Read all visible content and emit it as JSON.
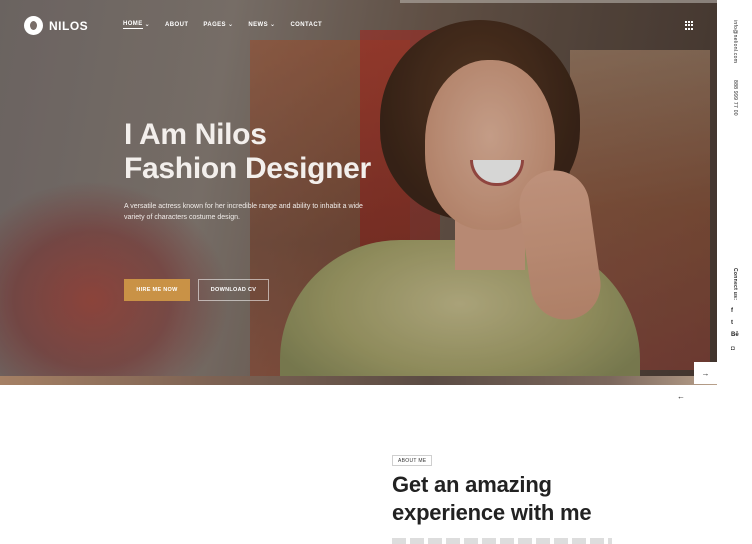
{
  "brand": {
    "name": "NILOS"
  },
  "nav": [
    {
      "label": "HOME",
      "dropdown": true,
      "active": true
    },
    {
      "label": "ABOUT",
      "dropdown": false
    },
    {
      "label": "PAGES",
      "dropdown": true
    },
    {
      "label": "NEWS",
      "dropdown": true
    },
    {
      "label": "CONTACT",
      "dropdown": false
    }
  ],
  "hero": {
    "title_line1": "I Am Nilos",
    "title_line2": "Fashion Designer",
    "description": "A versatile actress known for her incredible range and ability to inhabit a wide variety of characters costume design.",
    "hire_button": "HIRE ME NOW",
    "cv_button": "DOWNLOAD CV",
    "accent_color": "#c99246"
  },
  "sidebar": {
    "email": "info@nelionl.com",
    "phone": "888 999 77 00",
    "connect": "Connect us:",
    "socials": [
      "f",
      "t",
      "Bē",
      "◘"
    ]
  },
  "slider": {
    "next_arrow": "→",
    "prev_arrow": "←"
  },
  "about": {
    "badge": "ABOUT ME",
    "title_line1": "Get an amazing",
    "title_line2": "experience with me"
  }
}
